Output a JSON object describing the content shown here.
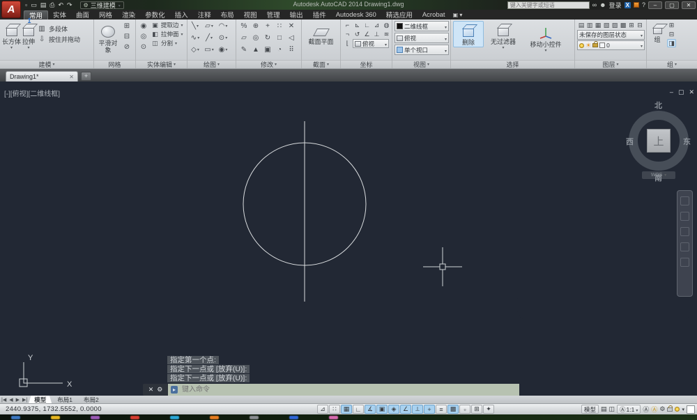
{
  "titlebar": {
    "workspace": "三维建模",
    "app_title": "Autodesk AutoCAD 2014   Drawing1.dwg",
    "search_placeholder": "键入关键字或短语",
    "sign_in": "登录",
    "qat_icons": [
      "▫",
      "▭",
      "▤",
      "⎙",
      "↶",
      "↷"
    ],
    "gear_icon": "⚙",
    "binoculars_icon": "∞",
    "user_icon": "☻",
    "exchange_badge": "X",
    "help_label": "?",
    "min_icon": "–",
    "max_icon": "▢",
    "close_icon": "✕"
  },
  "tabs": [
    "常用",
    "实体",
    "曲面",
    "网格",
    "渲染",
    "参数化",
    "插入",
    "注释",
    "布局",
    "视图",
    "管理",
    "输出",
    "插件",
    "Autodesk 360",
    "精选应用",
    "Acrobat"
  ],
  "panels": {
    "modeling": {
      "title": "建模",
      "box": "长方体",
      "extrude": "拉伸",
      "polysolid": "多段体",
      "presspull": "按住并拖动",
      "polysolid_icon": "▥",
      "presspull_icon": "⇩"
    },
    "mesh": {
      "title": "网格",
      "smooth": "平滑对象",
      "icons": [
        "⊞",
        "⊟",
        "⊘"
      ]
    },
    "solid": {
      "title": "实体编辑",
      "bool_icons": [
        "◉",
        "◎",
        "⊙"
      ],
      "rows": [
        "提取边",
        "拉伸面",
        "分割"
      ],
      "row_icons": [
        "▣",
        "◧",
        "◫"
      ]
    },
    "draw": {
      "title": "绘图",
      "icons": [
        "╲",
        "▱",
        "◠",
        "∿",
        "╱",
        "⊙",
        "◇",
        "▭",
        "◉"
      ]
    },
    "modify": {
      "title": "修改",
      "icons": [
        "%",
        "⊕",
        "+",
        "∷",
        "✕",
        "▱",
        "◎",
        "↻",
        "□",
        "◁",
        "✎",
        "▲",
        "▣",
        "◔",
        "⠿"
      ]
    },
    "section": {
      "title": "截面",
      "plane": "截面平面"
    },
    "coords": {
      "title": "坐标",
      "icons": [
        "⌐",
        "⊾",
        "∟",
        "⊿",
        "◍",
        "¬",
        "↺",
        "∠",
        "⊥",
        "≋",
        "⌊"
      ],
      "view_dd": "俯视"
    },
    "view": {
      "title": "视图",
      "style": "二维线框",
      "orient": "俯视",
      "viewport": "单个视口"
    },
    "selection": {
      "title": "选择",
      "erase": "删除",
      "filter": "无过滤器",
      "gizmo": "移动小控件"
    },
    "layers": {
      "title": "图层",
      "icons": [
        "▤",
        "▥",
        "▦",
        "▧",
        "▨",
        "▩",
        "⊞",
        "⊟"
      ],
      "state": "未保存的图层状态",
      "name": "0"
    },
    "group": {
      "title": "组",
      "label": "组",
      "side_icons": [
        "⊞",
        "⊟",
        "◨"
      ]
    }
  },
  "filetab": {
    "name": "Drawing1*",
    "close_icon": "✕",
    "new_icon": "+"
  },
  "canvas": {
    "viewport_label": "[-][俯视][二维线框]",
    "win_min": "–",
    "win_restore": "▢",
    "win_close": "✕",
    "viewcube": {
      "north": "北",
      "south": "南",
      "west": "西",
      "east": "东",
      "top": "上",
      "wcs": "WCS"
    },
    "ucs": {
      "x": "X",
      "y": "Y"
    }
  },
  "command": {
    "history": [
      "指定第一个点:",
      "指定下一点或 [放弃(U)]:",
      "指定下一点或 [放弃(U)]:"
    ],
    "placeholder": "键入命令",
    "badge": "▸",
    "close_icon": "✕",
    "wrench_icon": "⚙"
  },
  "layout_tabs": {
    "nav1": "|◀",
    "nav2": "◀",
    "nav3": "▶",
    "nav4": "▶|",
    "model": "模型",
    "l1": "布局1",
    "l2": "布局2"
  },
  "statusbar": {
    "coords": "2440.9375, 1732.5552, 0.0000",
    "toggles": [
      "⊿",
      "∷",
      "▦",
      "∟",
      "∡",
      "▣",
      "◈",
      "∠",
      "⟂",
      "+",
      "≡",
      "▩",
      "▫",
      "⊞",
      "✦"
    ],
    "model": "模型",
    "icon1": "▤",
    "icon2": "◫",
    "scale_icon": "Ⓐ",
    "scale": "1:1",
    "gear": "⚙",
    "caret": "▾"
  }
}
